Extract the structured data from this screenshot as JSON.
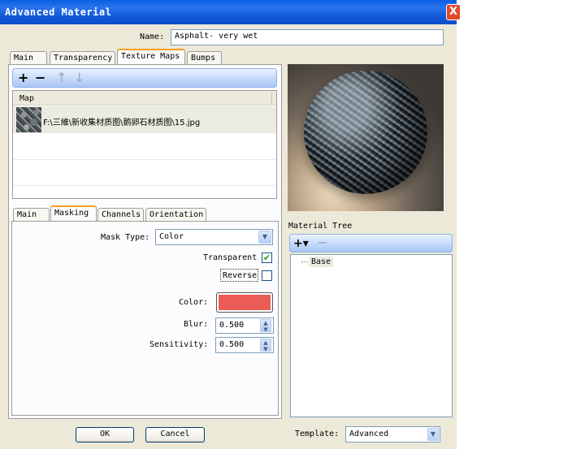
{
  "window": {
    "title": "Advanced Material",
    "close_glyph": "X"
  },
  "name_field": {
    "label": "Name:",
    "value": "Asphalt- very wet"
  },
  "top_tabs": [
    "Main",
    "Transparency",
    "Texture Maps",
    "Bumps"
  ],
  "maps_toolbar": {
    "add": "+",
    "remove": "−",
    "up": "↑",
    "down": "↓"
  },
  "map_table": {
    "header": "Map",
    "rows": [
      {
        "path": "F:\\三維\\新收集材质图\\鹅卵石材质图\\15.jpg",
        "thumb_icon": "stone-texture-thumbnail"
      }
    ]
  },
  "sub_tabs": [
    "Main",
    "Masking",
    "Channels",
    "Orientation"
  ],
  "masking": {
    "mask_type_label": "Mask Type:",
    "mask_type_value": "Color",
    "transparent_label": "Transparent",
    "transparent_checked": true,
    "reverse_label": "Reverse",
    "reverse_checked": false,
    "color_label": "Color:",
    "color_value": "#ec5c56",
    "blur_label": "Blur:",
    "blur_value": "0.500",
    "sensitivity_label": "Sensitivity:",
    "sensitivity_value": "0.500"
  },
  "material_tree": {
    "label": "Material Tree",
    "add": "+▾",
    "remove": "−",
    "items": [
      "Base"
    ]
  },
  "template": {
    "label": "Template:",
    "value": "Advanced"
  },
  "buttons": {
    "ok": "OK",
    "cancel": "Cancel"
  },
  "icons": {
    "combo_arrow": "chevron-down-icon",
    "checkmark": "✔"
  }
}
